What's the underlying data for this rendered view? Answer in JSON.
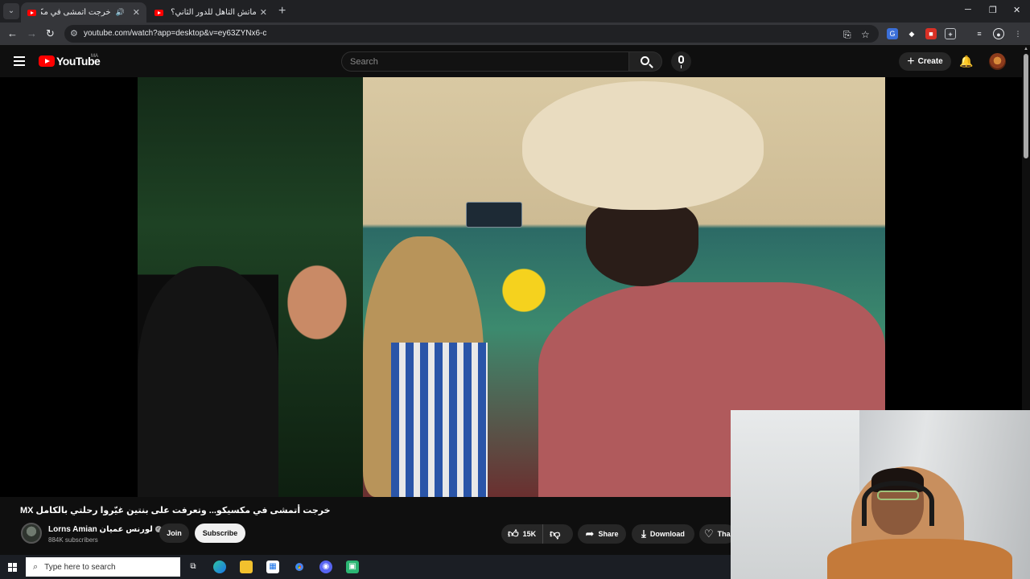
{
  "browser": {
    "tabs": [
      {
        "title": "خرجت أتمشى في مكسيكو... وتعرفت على بنتين غيّروا رحلتي بالكامل MX",
        "active": true,
        "audio_icon": "speaker-icon"
      },
      {
        "title": "ماتش التأهل للدور الثاني؟ التشك...",
        "active": false
      }
    ],
    "url": "youtube.com/watch?app=desktop&v=ey63ZYNx6-c",
    "colors": {
      "tab_bar": "#202124",
      "toolbar": "#35363a"
    }
  },
  "youtube": {
    "logo_text": "YouTube",
    "region": "MA",
    "search_placeholder": "Search",
    "create_label": "Create",
    "brand_color": "#ff0000"
  },
  "video": {
    "title": "خرجت أتمشى في مكسيكو... وتعرفت على بنتين غيّروا رحلتي بالكامل MX",
    "channel_name": "Lorns Amian لورنس عمیان",
    "subscribers": "884K subscribers",
    "join_label": "Join",
    "subscribe_label": "Subscribe",
    "likes": "15K",
    "share_label": "Share",
    "download_label": "Download",
    "thanks_label": "Tha"
  },
  "taskbar": {
    "search_placeholder": "Type here to search",
    "apps": [
      "task-view-icon",
      "edge-icon",
      "file-explorer-icon",
      "store-icon",
      "chrome-icon",
      "discord-icon",
      "app-icon"
    ]
  }
}
